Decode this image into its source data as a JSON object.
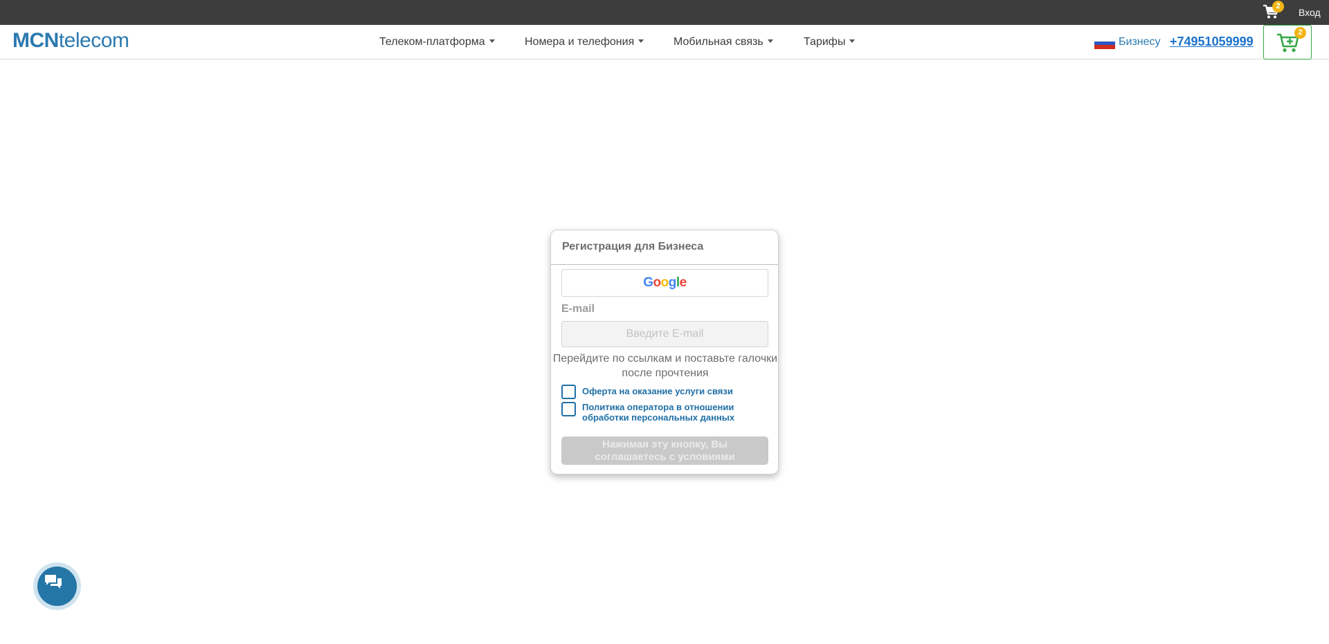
{
  "topbar": {
    "cart_count": "2",
    "login_label": "Вход"
  },
  "header": {
    "logo_bold": "MCN",
    "logo_rest": "telecom",
    "nav": [
      {
        "label": "Телеком-платформа"
      },
      {
        "label": "Номера и телефония"
      },
      {
        "label": "Мобильная связь"
      },
      {
        "label": "Тарифы"
      }
    ],
    "segment_label": "Бизнесу",
    "phone": "+74951059999",
    "cart_count": "2"
  },
  "form": {
    "title": "Регистрация для Бизнеса",
    "google_letters": [
      "G",
      "o",
      "o",
      "g",
      "l",
      "e"
    ],
    "email_label": "E-mail",
    "email_placeholder": "Введите E-mail",
    "email_value": "",
    "hint_line1": "Перейдите по ссылкам и поставьте галочки",
    "hint_line2": "после прочтения",
    "checkbox_offer": "Оферта на оказание услуги связи",
    "checkbox_policy_line1": "Политика оператора в отношении",
    "checkbox_policy_line2": "обработки персональных данных",
    "submit_line1": "Нажимая эту кнопку, Вы",
    "submit_line2": "соглашаетесь с условиями"
  },
  "colors": {
    "topbar": "#3d3d3d",
    "brand": "#2b7ab0",
    "phone": "#1b72c9",
    "cart_border": "#35a845",
    "badge": "#f3b512",
    "checkbox": "#1f6fa6",
    "submit_disabled": "#c9c9c9",
    "chat_button": "#2476a6",
    "google": [
      "#4285f4",
      "#ea4335",
      "#fbbc05",
      "#4285f4",
      "#34a853",
      "#ea4335"
    ],
    "flag": [
      "#ffffff",
      "#2f56c6",
      "#d52b1e"
    ]
  },
  "icons": {
    "top_cart": "cart-icon",
    "header_cart": "cart-plus-icon",
    "flag": "russia-flag-icon",
    "chat": "chat-bubbles-icon",
    "caret": "caret-down-icon"
  }
}
